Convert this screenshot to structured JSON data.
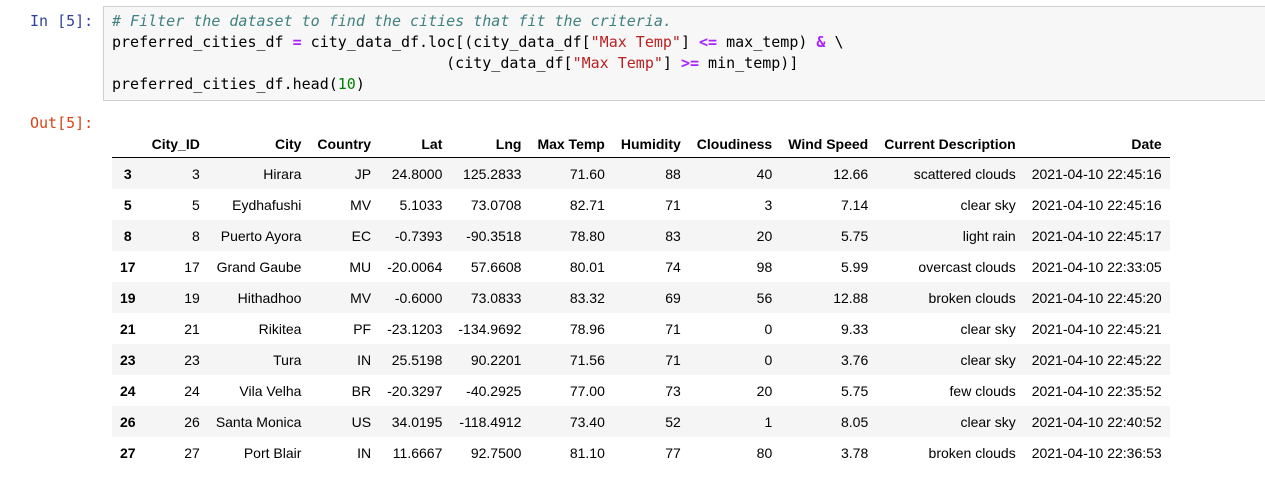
{
  "cell": {
    "in_prompt": "In [5]:",
    "out_prompt": "Out[5]:",
    "code": {
      "comment": "# Filter the dataset to find the cities that fit the criteria.",
      "line2": {
        "a": "preferred_cities_df ",
        "eq": "=",
        "b": " city_data_df.loc[(city_data_df[",
        "s": "\"Max Temp\"",
        "c": "] ",
        "op": "<=",
        "d": " max_temp) ",
        "amp": "&",
        "e": " \\"
      },
      "line3": {
        "indent": "                                     (city_data_df[",
        "s": "\"Max Temp\"",
        "c": "] ",
        "op": ">=",
        "d": " min_temp)]"
      },
      "line4": {
        "a": "preferred_cities_df.head(",
        "num": "10",
        "b": ")"
      }
    }
  },
  "table": {
    "columns": [
      "",
      "City_ID",
      "City",
      "Country",
      "Lat",
      "Lng",
      "Max Temp",
      "Humidity",
      "Cloudiness",
      "Wind Speed",
      "Current Description",
      "Date"
    ],
    "rows": [
      [
        "3",
        "3",
        "Hirara",
        "JP",
        "24.8000",
        "125.2833",
        "71.60",
        "88",
        "40",
        "12.66",
        "scattered clouds",
        "2021-04-10 22:45:16"
      ],
      [
        "5",
        "5",
        "Eydhafushi",
        "MV",
        "5.1033",
        "73.0708",
        "82.71",
        "71",
        "3",
        "7.14",
        "clear sky",
        "2021-04-10 22:45:16"
      ],
      [
        "8",
        "8",
        "Puerto Ayora",
        "EC",
        "-0.7393",
        "-90.3518",
        "78.80",
        "83",
        "20",
        "5.75",
        "light rain",
        "2021-04-10 22:45:17"
      ],
      [
        "17",
        "17",
        "Grand Gaube",
        "MU",
        "-20.0064",
        "57.6608",
        "80.01",
        "74",
        "98",
        "5.99",
        "overcast clouds",
        "2021-04-10 22:33:05"
      ],
      [
        "19",
        "19",
        "Hithadhoo",
        "MV",
        "-0.6000",
        "73.0833",
        "83.32",
        "69",
        "56",
        "12.88",
        "broken clouds",
        "2021-04-10 22:45:20"
      ],
      [
        "21",
        "21",
        "Rikitea",
        "PF",
        "-23.1203",
        "-134.9692",
        "78.96",
        "71",
        "0",
        "9.33",
        "clear sky",
        "2021-04-10 22:45:21"
      ],
      [
        "23",
        "23",
        "Tura",
        "IN",
        "25.5198",
        "90.2201",
        "71.56",
        "71",
        "0",
        "3.76",
        "clear sky",
        "2021-04-10 22:45:22"
      ],
      [
        "24",
        "24",
        "Vila Velha",
        "BR",
        "-20.3297",
        "-40.2925",
        "77.00",
        "73",
        "20",
        "5.75",
        "few clouds",
        "2021-04-10 22:35:52"
      ],
      [
        "26",
        "26",
        "Santa Monica",
        "US",
        "34.0195",
        "-118.4912",
        "73.40",
        "52",
        "1",
        "8.05",
        "clear sky",
        "2021-04-10 22:40:52"
      ],
      [
        "27",
        "27",
        "Port Blair",
        "IN",
        "11.6667",
        "92.7500",
        "81.10",
        "77",
        "80",
        "3.78",
        "broken clouds",
        "2021-04-10 22:36:53"
      ]
    ]
  }
}
